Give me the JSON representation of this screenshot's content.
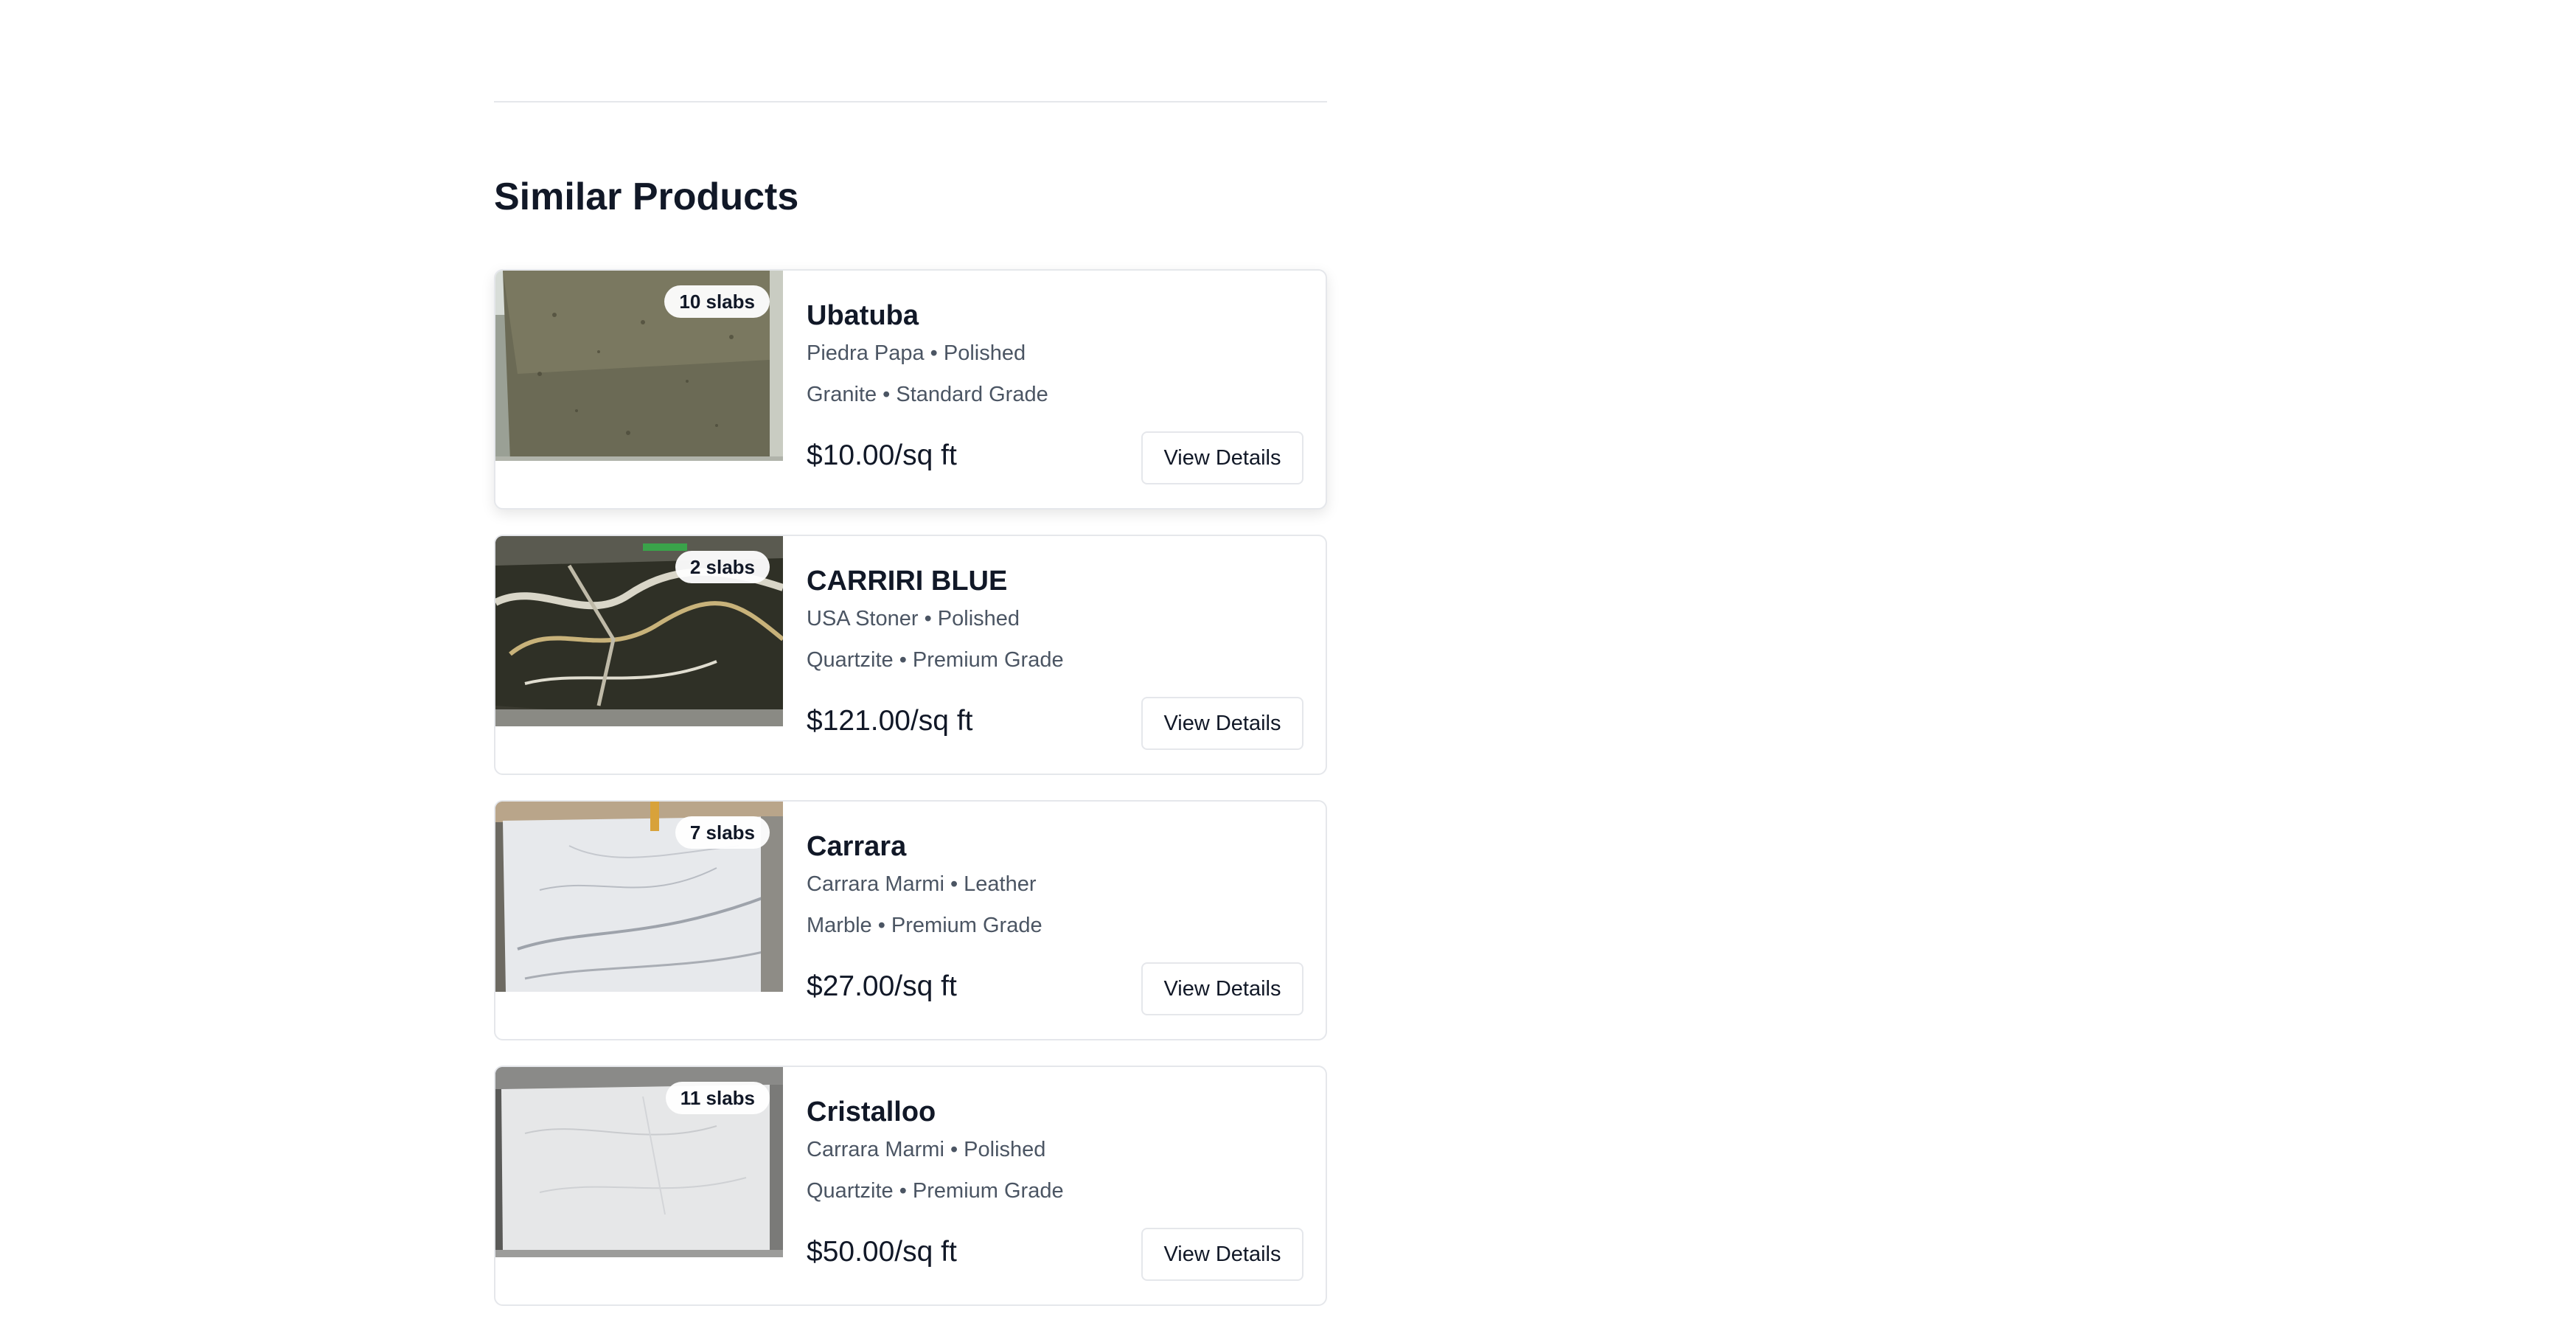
{
  "section": {
    "title": "Similar Products"
  },
  "products": [
    {
      "name": "Ubatuba",
      "supplier_finish": "Piedra Papa • Polished",
      "material_grade": "Granite • Standard Grade",
      "price": "$10.00/sq ft",
      "slabs": "10 slabs",
      "button_label": "View Details",
      "image": "granite-slab-image"
    },
    {
      "name": "CARRIRI BLUE",
      "supplier_finish": "USA Stoner • Polished",
      "material_grade": "Quartzite • Premium Grade",
      "price": "$121.00/sq ft",
      "slabs": "2 slabs",
      "button_label": "View Details",
      "image": "quartzite-slab-image"
    },
    {
      "name": "Carrara",
      "supplier_finish": "Carrara Marmi • Leather",
      "material_grade": "Marble • Premium Grade",
      "price": "$27.00/sq ft",
      "slabs": "7 slabs",
      "button_label": "View Details",
      "image": "marble-slab-image"
    },
    {
      "name": "Cristalloo",
      "supplier_finish": "Carrara Marmi • Polished",
      "material_grade": "Quartzite • Premium Grade",
      "price": "$50.00/sq ft",
      "slabs": "11 slabs",
      "button_label": "View Details",
      "image": "white-quartzite-slab-image"
    }
  ],
  "colors": {
    "border": "#e5e7eb",
    "text_primary": "#111827",
    "text_secondary": "#4b5563"
  }
}
